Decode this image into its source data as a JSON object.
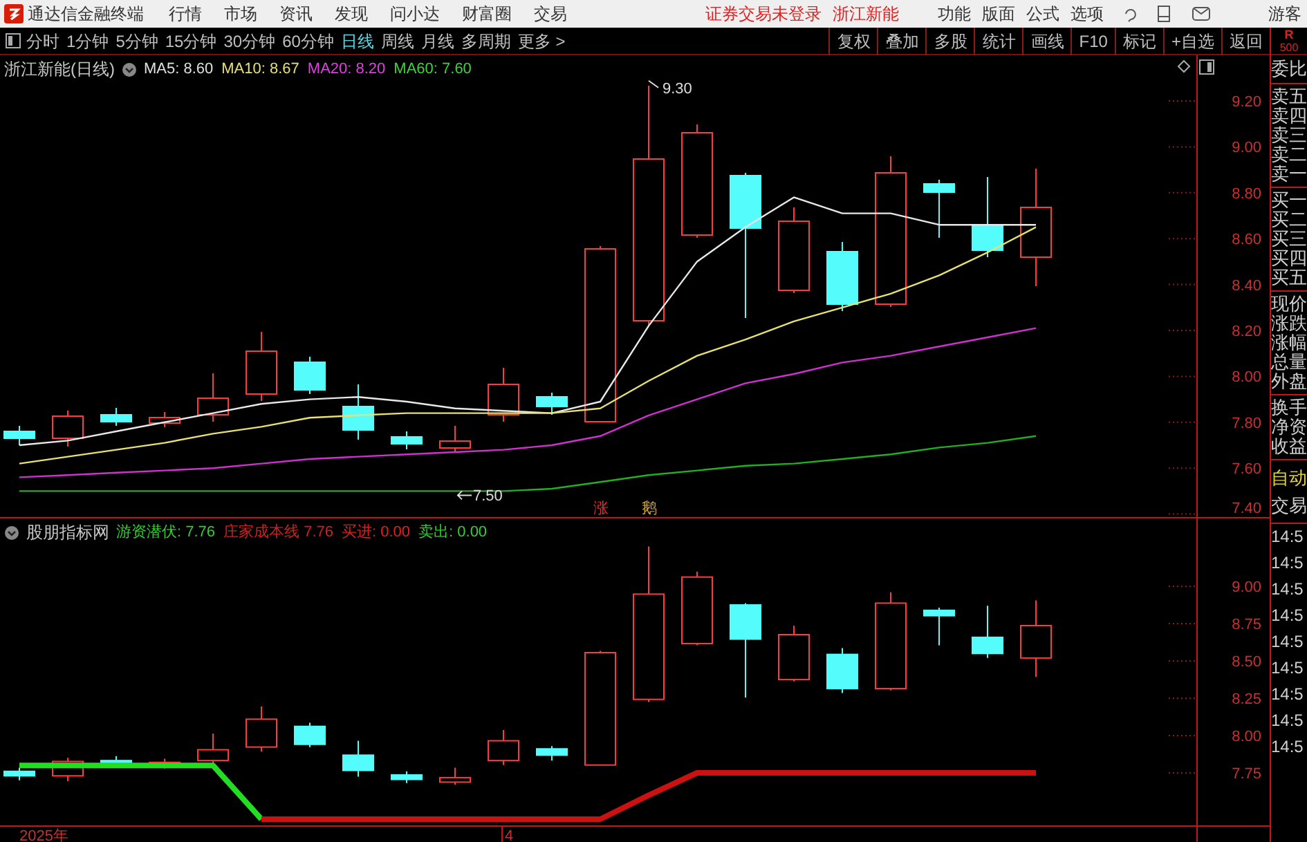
{
  "app": {
    "title": "通达信金融终端",
    "menu": [
      "行情",
      "市场",
      "资讯",
      "发现",
      "问小达",
      "财富圈",
      "交易"
    ],
    "notice": "证券交易未登录",
    "stock": "浙江新能",
    "tools": [
      "功能",
      "版面",
      "公式",
      "选项"
    ],
    "user": "游客"
  },
  "periods": [
    {
      "label": "分时",
      "selected": false
    },
    {
      "label": "1分钟",
      "selected": false
    },
    {
      "label": "5分钟",
      "selected": false
    },
    {
      "label": "15分钟",
      "selected": false
    },
    {
      "label": "30分钟",
      "selected": false
    },
    {
      "label": "60分钟",
      "selected": false
    },
    {
      "label": "日线",
      "selected": true
    },
    {
      "label": "周线",
      "selected": false
    },
    {
      "label": "月线",
      "selected": false
    },
    {
      "label": "多周期",
      "selected": false
    },
    {
      "label": "更多 >",
      "selected": false
    }
  ],
  "actions": [
    "复权",
    "叠加",
    "多股",
    "统计",
    "画线",
    "F10",
    "标记",
    "+自选",
    "返回"
  ],
  "main_chart": {
    "title": "浙江新能(日线)",
    "legend": [
      {
        "label": "MA5: 8.60",
        "color": "#e0e0e0"
      },
      {
        "label": "MA10: 8.67",
        "color": "#e8e070"
      },
      {
        "label": "MA20: 8.20",
        "color": "#e040e0"
      },
      {
        "label": "MA60: 7.60",
        "color": "#40d040"
      }
    ],
    "signals": [
      {
        "text": "涨",
        "color": "#e03030"
      },
      {
        "text": "鹅",
        "color": "#d0a030"
      }
    ],
    "price_axis": [
      "9.20",
      "9.00",
      "8.80",
      "8.60",
      "8.40",
      "8.20",
      "8.00",
      "7.80",
      "7.60",
      "7.40"
    ],
    "annotations": [
      "9.30",
      "7.50"
    ]
  },
  "indicator_chart": {
    "title": "股朋指标网",
    "legend": [
      {
        "label": "游资潜伏: 7.76",
        "color": "#30d030"
      },
      {
        "label": "庄家成本线 7.76",
        "color": "#d02020"
      },
      {
        "label": "买进: 0.00",
        "color": "#e02020"
      },
      {
        "label": "卖出: 0.00",
        "color": "#30d030"
      }
    ],
    "price_axis": [
      "9.00",
      "8.75",
      "8.50",
      "8.25",
      "8.00",
      "7.75"
    ]
  },
  "x_axis": [
    "2025年",
    "4"
  ],
  "side_panel": {
    "badge": "R",
    "badge_sub": "500",
    "header": "委比",
    "groups": [
      [
        "卖五",
        "卖四",
        "卖三",
        "卖二",
        "卖一"
      ],
      [
        "买一",
        "买二",
        "买三",
        "买四",
        "买五"
      ],
      [
        "现价",
        "涨跌",
        "涨幅",
        "总量",
        "外盘"
      ],
      [
        "换手",
        "净资",
        "收益"
      ]
    ],
    "trade": [
      {
        "text": "自动",
        "kind": "mode"
      },
      {
        "text": "交易",
        "kind": "title"
      }
    ],
    "times": [
      "14:5",
      "14:5",
      "14:5",
      "14:5",
      "14:5",
      "14:5",
      "14:5",
      "14:5",
      "14:5"
    ]
  }
}
